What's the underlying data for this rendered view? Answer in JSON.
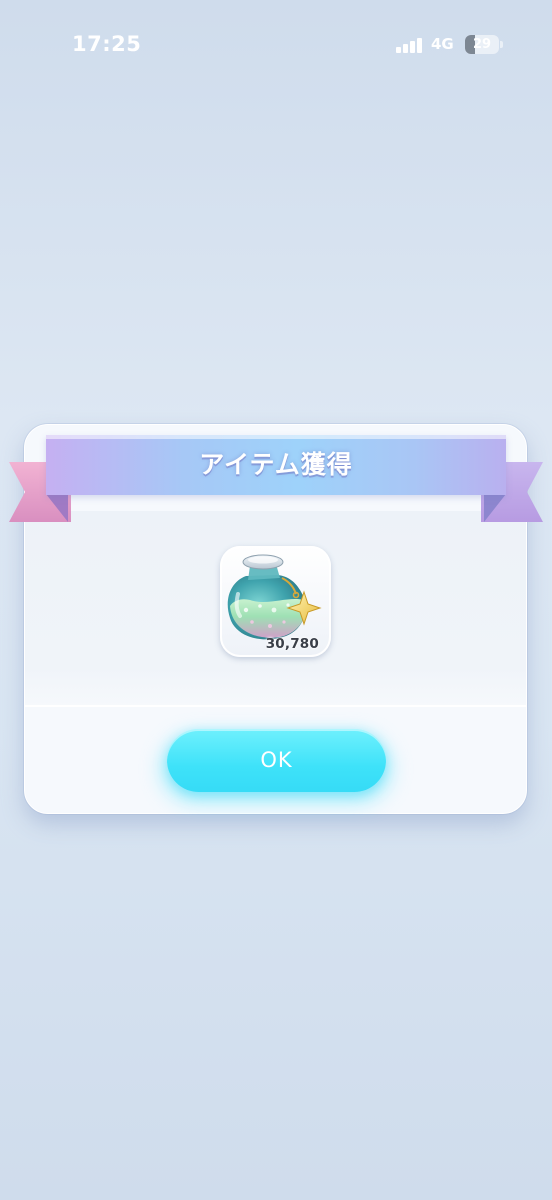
{
  "status_bar": {
    "time": "17:25",
    "network": "4G",
    "battery_level": "29",
    "battery_fraction": 0.29,
    "signal_bars": 4
  },
  "dialog": {
    "title": "アイテム獲得",
    "item": {
      "icon": "potion-bottle-icon",
      "count": "30,780"
    },
    "ok_label": "OK"
  },
  "colors": {
    "background": "#d9e5f2",
    "ribbon_left": "#c5b0f2",
    "ribbon_center": "#9ed2fa",
    "ribbon_tail_pink": "#f2b3d3",
    "ok_button": "#3ee2f9",
    "text_dark": "#3a3f48"
  }
}
